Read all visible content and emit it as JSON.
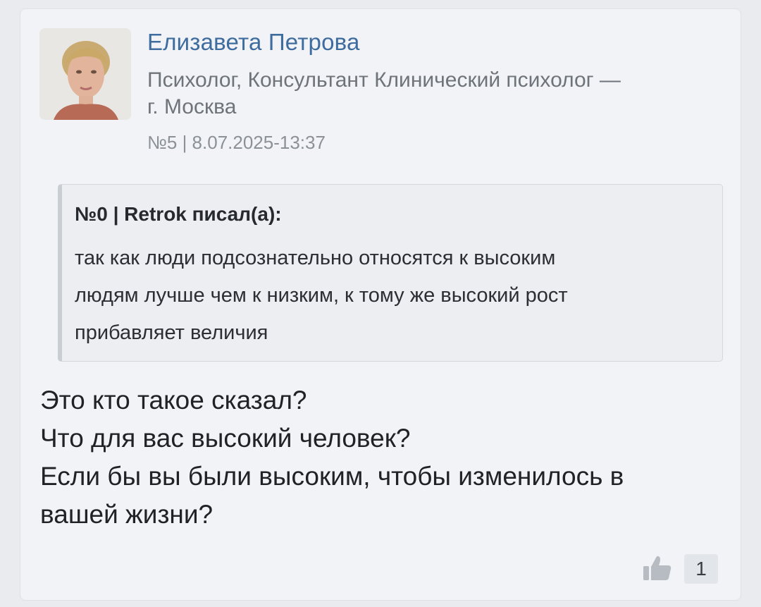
{
  "author": {
    "name": "Елизавета Петрова",
    "role_line1": "Психолог, Консультант Клинический психолог —",
    "role_line2": "г. Москва"
  },
  "post": {
    "meta": "№5 | 8.07.2025-13:37",
    "body_lines": [
      "Это кто такое сказал?",
      "Что для вас высокий человек?",
      "Если бы вы были высоким, чтобы изменилось в",
      "вашей жизни?"
    ]
  },
  "quote": {
    "header": "№0 | Retrok писал(а):",
    "lines": [
      "так как люди подсознательно относятся к высоким",
      "людям лучше чем к низким, к тому же высокий рост",
      "прибавляет величия"
    ]
  },
  "likes": {
    "icon": "thumbs-up-icon",
    "count": "1"
  },
  "colors": {
    "background": "#e9ebef",
    "card": "#f1f3f6",
    "author_name": "#3f6c9e"
  }
}
